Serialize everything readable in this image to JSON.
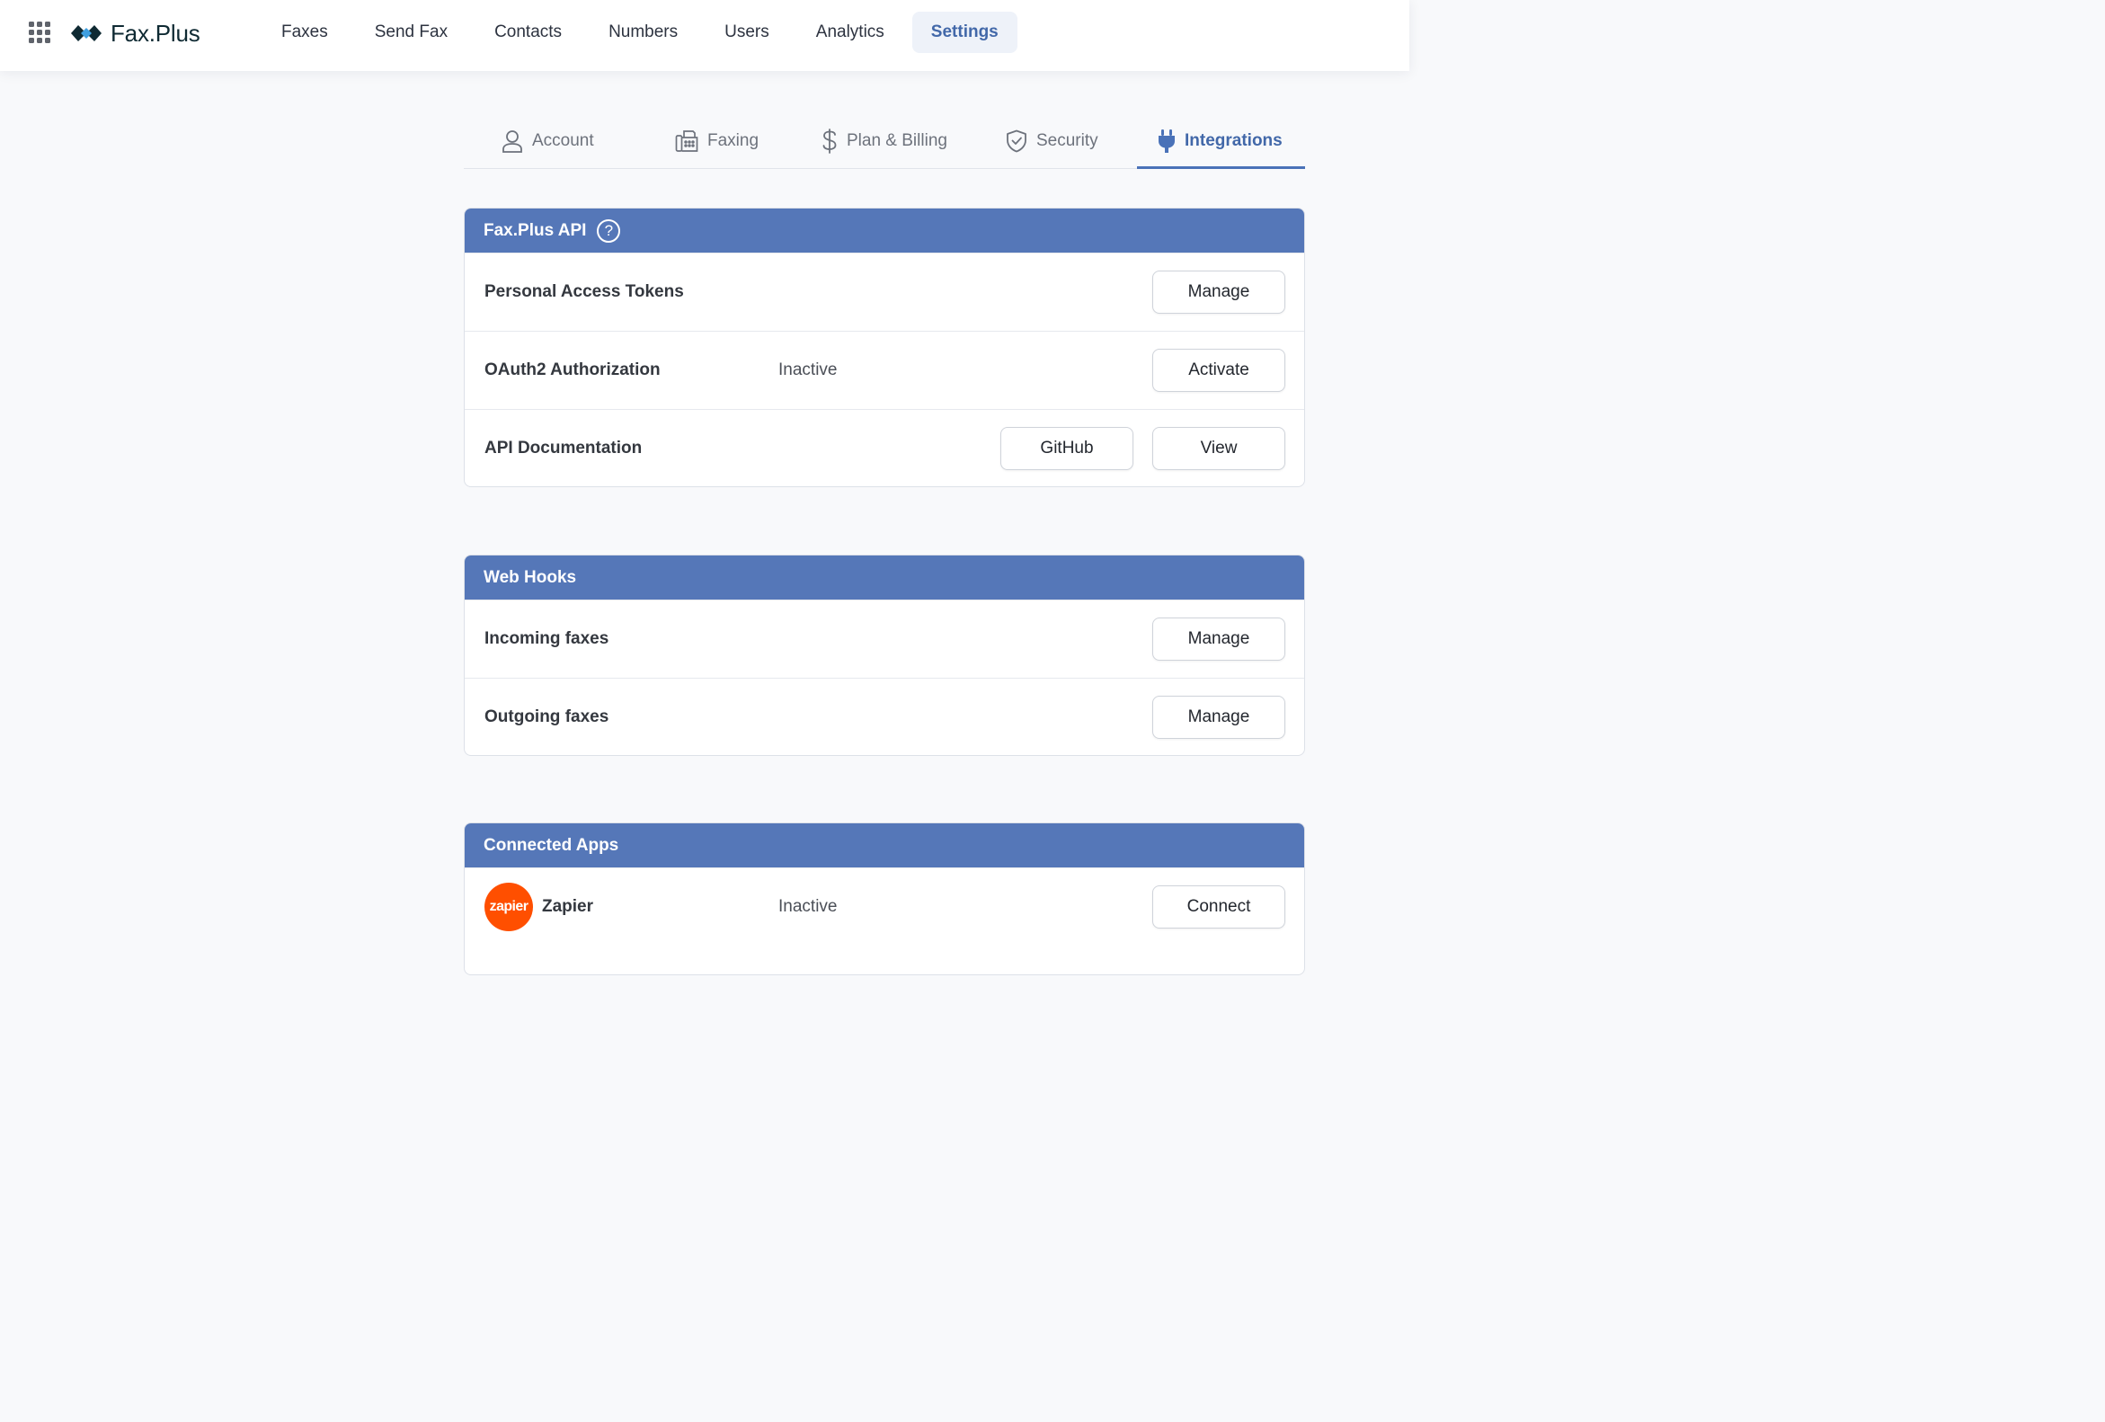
{
  "app": {
    "name": "Fax.Plus"
  },
  "nav": {
    "items": [
      {
        "label": "Faxes"
      },
      {
        "label": "Send Fax"
      },
      {
        "label": "Contacts"
      },
      {
        "label": "Numbers"
      },
      {
        "label": "Users"
      },
      {
        "label": "Analytics"
      },
      {
        "label": "Settings",
        "active": true
      }
    ]
  },
  "tabs": [
    {
      "label": "Account",
      "icon": "user-icon"
    },
    {
      "label": "Faxing",
      "icon": "fax-machine-icon"
    },
    {
      "label": "Plan & Billing",
      "icon": "dollar-icon"
    },
    {
      "label": "Security",
      "icon": "shield-check-icon"
    },
    {
      "label": "Integrations",
      "icon": "plug-icon",
      "active": true
    }
  ],
  "api": {
    "title": "Fax.Plus API",
    "help_glyph": "?",
    "rows": [
      {
        "title": "Personal Access Tokens",
        "button": "Manage"
      },
      {
        "title": "OAuth2 Authorization",
        "status": "Inactive",
        "button": "Activate"
      },
      {
        "title": "API Documentation",
        "button_secondary": "GitHub",
        "button": "View"
      }
    ]
  },
  "webhooks": {
    "title": "Web Hooks",
    "rows": [
      {
        "title": "Incoming faxes",
        "button": "Manage"
      },
      {
        "title": "Outgoing faxes",
        "button": "Manage"
      }
    ]
  },
  "connected_apps": {
    "title": "Connected Apps",
    "rows": [
      {
        "logo_text": "zapier",
        "title": "Zapier",
        "status": "Inactive",
        "button": "Connect"
      }
    ]
  },
  "colors": {
    "accent": "#4268a9",
    "card_header": "#5577b8",
    "zapier": "#ff4f00",
    "page_background": "#f8f9fb"
  }
}
